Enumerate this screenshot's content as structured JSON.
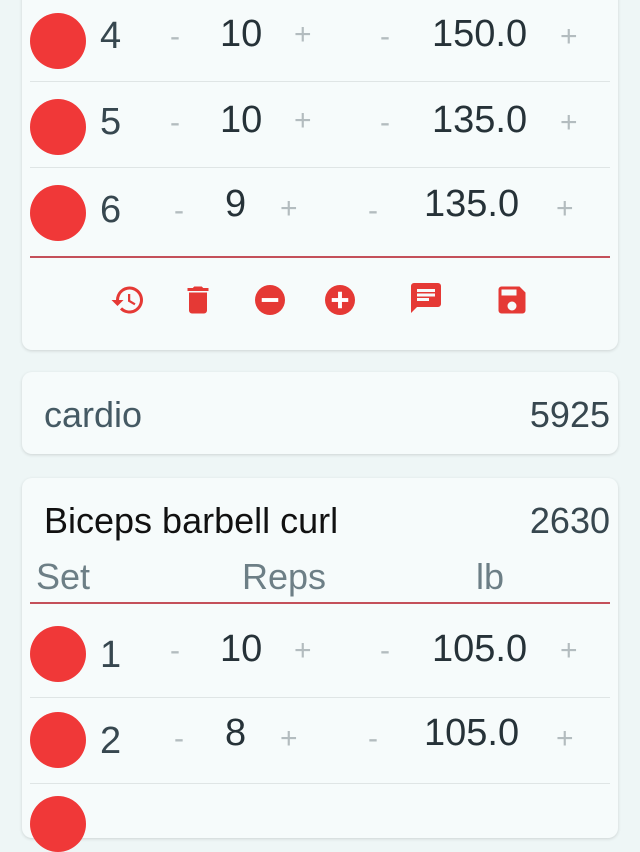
{
  "top_exercise": {
    "rows": [
      {
        "set": "4",
        "reps": "10",
        "weight": "150.0"
      },
      {
        "set": "5",
        "reps": "10",
        "weight": "135.0"
      },
      {
        "set": "6",
        "reps": "9",
        "weight": "135.0"
      }
    ],
    "toolbar": [
      "history-icon",
      "delete-icon",
      "remove-circle-icon",
      "add-circle-icon",
      "comment-icon",
      "save-icon"
    ]
  },
  "cardio": {
    "label": "cardio",
    "total": "5925"
  },
  "curl": {
    "title": "Biceps barbell curl",
    "total": "2630",
    "headers": {
      "set": "Set",
      "reps": "Reps",
      "unit": "lb"
    },
    "rows": [
      {
        "set": "1",
        "reps": "10",
        "weight": "105.0"
      },
      {
        "set": "2",
        "reps": "8",
        "weight": "105.0"
      }
    ]
  },
  "controls": {
    "minus": "-",
    "plus": "+"
  },
  "colors": {
    "accent": "#f03838",
    "background": "#eef6f6",
    "card": "#f6fbfb"
  }
}
